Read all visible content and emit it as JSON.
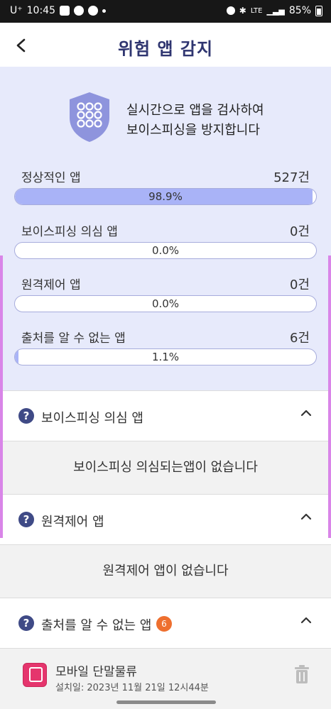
{
  "status_bar": {
    "carrier": "U⁺",
    "time": "10:45",
    "network": "LTE",
    "battery": "85%"
  },
  "header": {
    "back_icon": "chevron-left-icon",
    "title": "위험 앱 감지"
  },
  "summary": {
    "intro_line1": "실시간으로 앱을 검사하여",
    "intro_line2": "보이스피싱을 방지합니다",
    "stats": [
      {
        "label": "정상적인 앱",
        "count": "527건",
        "percent_text": "98.9%",
        "percent": 98.9
      },
      {
        "label": "보이스피싱 의심 앱",
        "count": "0건",
        "percent_text": "0.0%",
        "percent": 0.0
      },
      {
        "label": "원격제어 앱",
        "count": "0건",
        "percent_text": "0.0%",
        "percent": 0.0
      },
      {
        "label": "출처를 알 수 없는 앱",
        "count": "6건",
        "percent_text": "1.1%",
        "percent": 1.1
      }
    ]
  },
  "sections": {
    "voice_phishing": {
      "title": "보이스피싱 의심 앱",
      "empty_text": "보이스피싱 의심되는앱이 없습니다"
    },
    "remote_control": {
      "title": "원격제어 앱",
      "empty_text": "원격제어 앱이 없습니다"
    },
    "unknown_source": {
      "title": "출처를 알 수 없는 앱",
      "badge": "6"
    }
  },
  "apps": [
    {
      "name": "모바일 단말물류",
      "install_date": "설치일: 2023년 11월 21일 12시44분"
    }
  ],
  "colors": {
    "title": "#2f3570",
    "panel_bg": "#e7eafb",
    "bar_fill": "#a9b3f7",
    "badge": "#ee6f2f",
    "help_icon": "#3f4a86"
  }
}
